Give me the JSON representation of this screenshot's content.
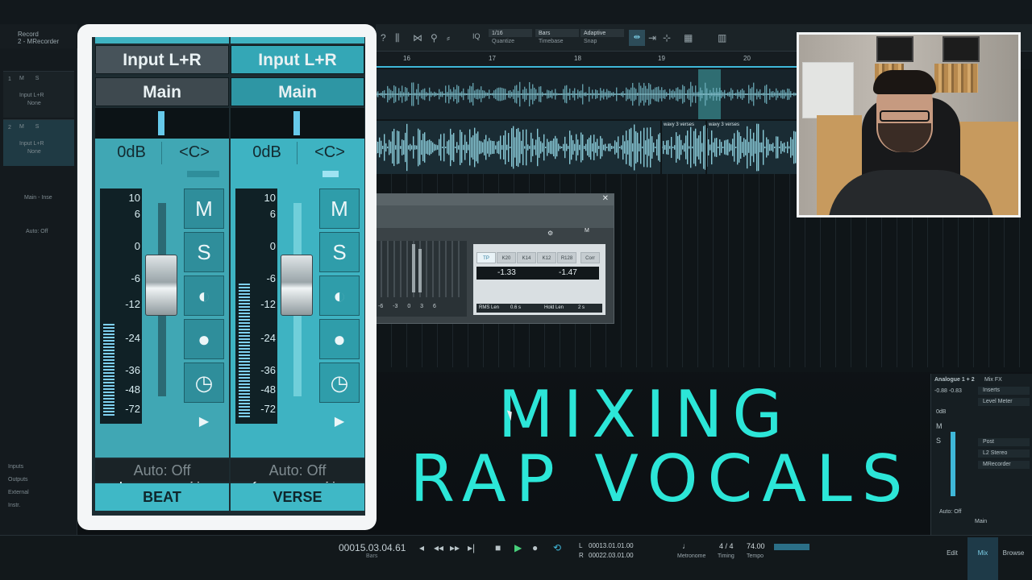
{
  "left_panel": {
    "header_title": "Record",
    "header_sub": "2 - MRecorder",
    "tracks": [
      {
        "num": "1",
        "ms": "M S",
        "input": "Input L+R",
        "out": "None"
      },
      {
        "num": "2",
        "ms": "M S",
        "input": "Input L+R",
        "out": "None"
      }
    ],
    "inserts_label": "Main - Inse",
    "auto": "Auto: Off",
    "io_labels": [
      "Inputs",
      "Outputs",
      "External",
      "Instr."
    ]
  },
  "toolbar": {
    "quantize_value": "1/16",
    "quantize_label": "Quantize",
    "timebase_value": "Bars",
    "timebase_label": "Timebase",
    "snap_value": "Adaptive",
    "snap_label": "Snap",
    "iq_label": "IQ"
  },
  "ruler": {
    "ticks": [
      "16",
      "17",
      "18",
      "19",
      "20"
    ]
  },
  "clips": {
    "label_a": "wavy 3 verses",
    "label_b": "wavy 3 verses"
  },
  "plugin": {
    "tabs": [
      "TP",
      "K20",
      "K14",
      "K12",
      "R128",
      "Corr"
    ],
    "readout_left": "-1.33",
    "readout_right": "-1.47",
    "rms_label": "RMS Len",
    "rms_value": "0.6 s",
    "hold_label": "Hold Len",
    "hold_value": "2 s",
    "scale": "-6 -3 0 3 6",
    "m_tag": "M"
  },
  "mixer": {
    "channels": [
      {
        "input": "Input L+R",
        "output": "Main",
        "gain": "0dB",
        "pan": "<C>",
        "number": "1",
        "auto": "Auto: Off",
        "name": "BEAT",
        "meter_level": 0.42
      },
      {
        "input": "Input L+R",
        "output": "Main",
        "gain": "0dB",
        "pan": "<C>",
        "number": "2",
        "auto": "Auto: Off",
        "name": "VERSE",
        "meter_level": 0.6
      }
    ],
    "scale": [
      "10",
      "6",
      "0",
      "-6",
      "-12",
      "-24",
      "-36",
      "-48",
      "-72"
    ],
    "buttons": {
      "mute": "M",
      "solo": "S"
    }
  },
  "title": {
    "line1": "MIXING",
    "line2": "RAP VOCALS"
  },
  "right_mixer": {
    "channel": "Analogue 1 + 2",
    "mixfx": "Mix FX",
    "inserts": "Inserts",
    "level_meter": "Level Meter",
    "post": "Post",
    "l2": "L2 Stereo",
    "mrecorder": "MRecorder",
    "vals": "-0.88  -0.83",
    "odb": "0dB",
    "m": "M",
    "s": "S",
    "auto": "Auto: Off",
    "main": "Main"
  },
  "transport": {
    "time": "00015.03.04.61",
    "bars": "Bars",
    "l_time": "00013.01.01.00",
    "r_time": "00022.03.01.00",
    "l": "L",
    "r": "R",
    "metronome": "Metronome",
    "timing_value": "4 / 4",
    "timing": "Timing",
    "tempo_value": "74.00",
    "tempo": "Tempo",
    "tabs": [
      "Edit",
      "Mix",
      "Browse"
    ]
  },
  "colors": {
    "accent": "#2ce6d8",
    "channel_teal": "#3fb8c6",
    "active_blue": "#3fb7d8"
  }
}
